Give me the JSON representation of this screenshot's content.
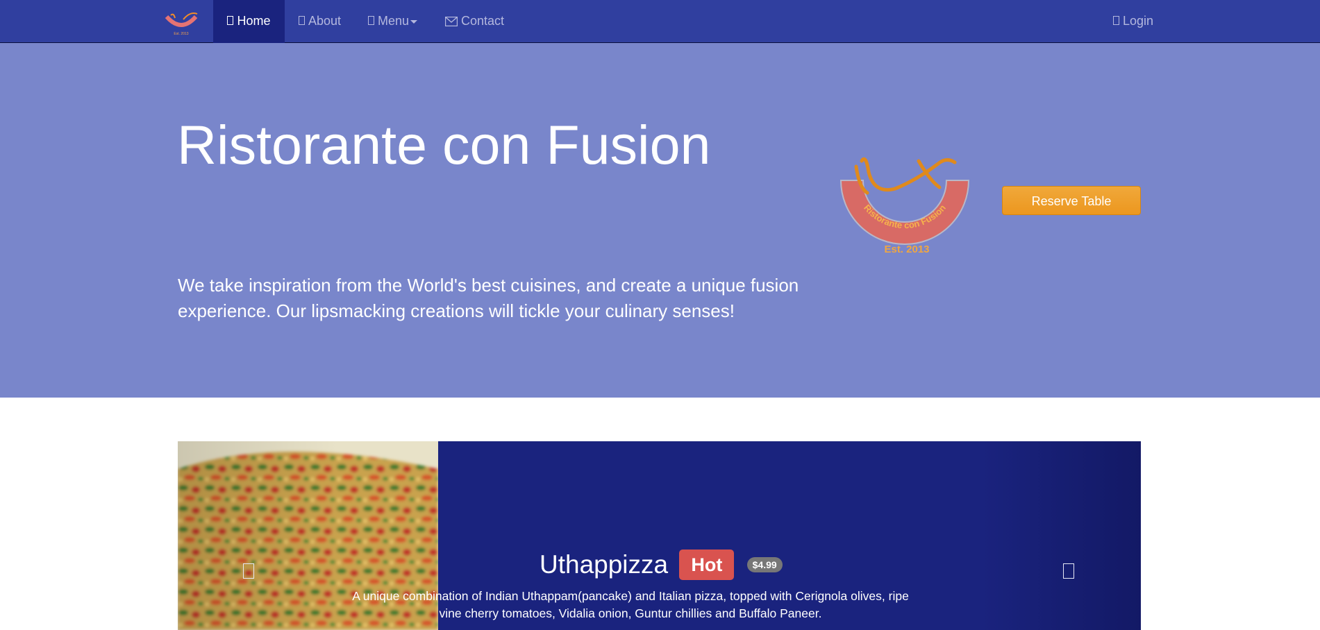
{
  "navbar": {
    "items": [
      {
        "label": "Home",
        "icon": "home-icon"
      },
      {
        "label": "About",
        "icon": "info-icon"
      },
      {
        "label": "Menu",
        "icon": "list-icon"
      },
      {
        "label": "Contact",
        "icon": "envelope-icon"
      }
    ],
    "login": {
      "label": "Login",
      "icon": "sign-in-icon"
    }
  },
  "jumbotron": {
    "title": "Ristorante con Fusion",
    "text": "We take inspiration from the World's best cuisines, and create a unique fusion experience. Our lipsmacking creations will tickle your culinary senses!",
    "logo": {
      "ring_text": "Ristorante con Fusion",
      "est_text": "Est. 2013"
    },
    "reserve_label": "Reserve Table"
  },
  "carousel": {
    "slide": {
      "title": "Uthappizza",
      "label": "Hot",
      "price": "$4.99",
      "description": "A unique combination of Indian Uthappam(pancake) and Italian pizza, topped with Cerignola olives, ripe vine cherry tomatoes, Vidalia onion, Guntur chillies and Buffalo Paneer."
    }
  },
  "colors": {
    "navbar": "#303f9f",
    "navbar_active": "#1a237e",
    "jumbotron": "#7986cb",
    "carousel": "#1a237e",
    "warning": "#ec971f",
    "danger": "#d9534f"
  }
}
